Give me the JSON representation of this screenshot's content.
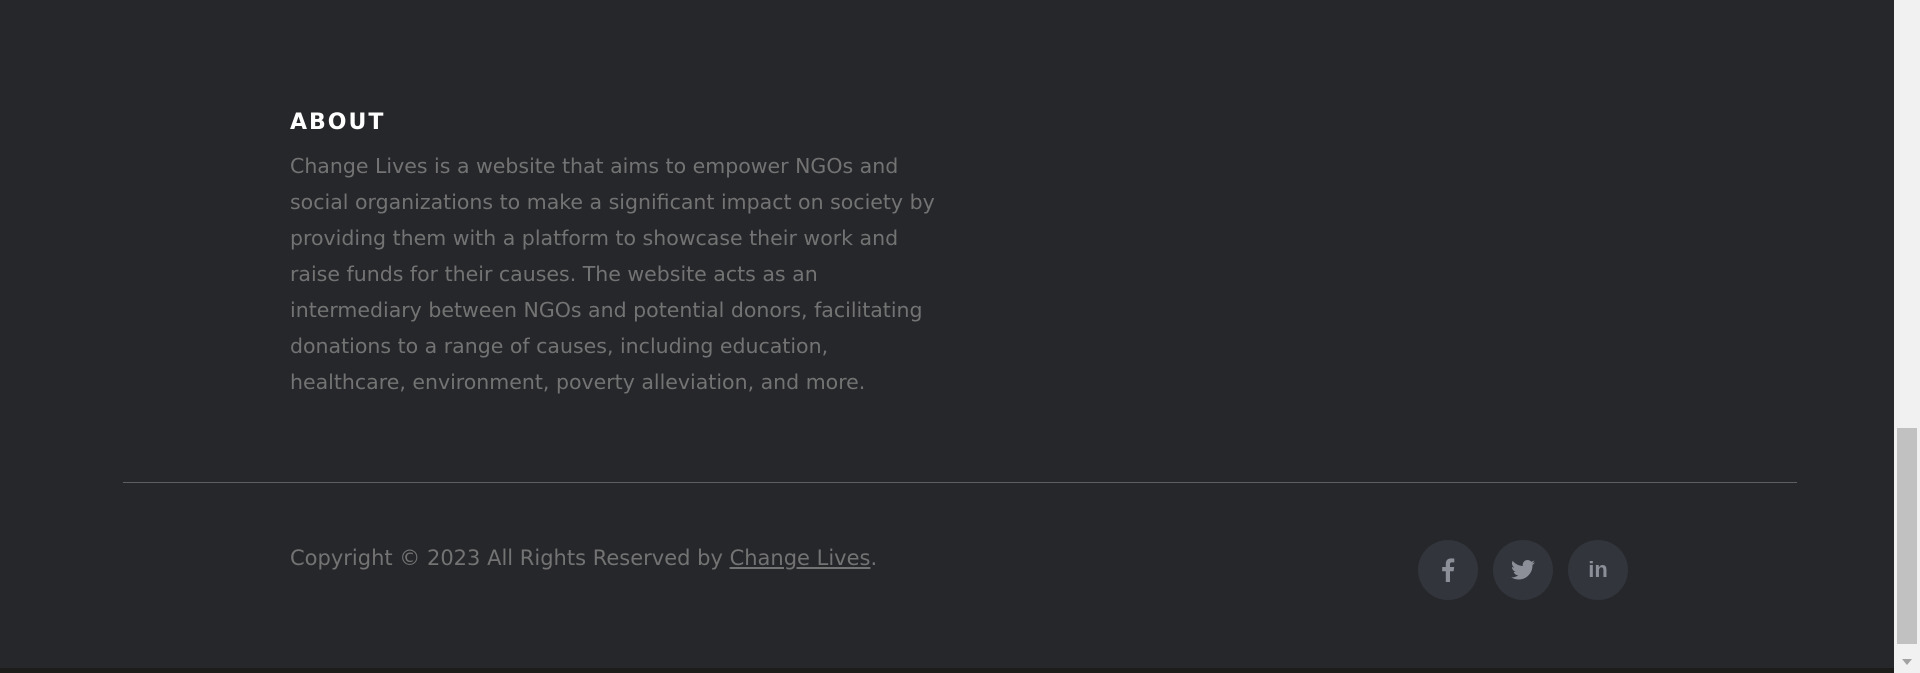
{
  "about": {
    "title": "ABOUT",
    "text": "Change Lives is a website that aims to empower NGOs and social organizations to make a significant impact on society by providing them with a platform to showcase their work and raise funds for their causes. The website acts as an intermediary between NGOs and potential donors, facilitating donations to a range of causes, including education, healthcare, environment, poverty alleviation, and more."
  },
  "footer": {
    "copyright_prefix": "Copyright © 2023 All Rights Reserved by ",
    "copyright_link": "Change Lives",
    "copyright_suffix": "."
  },
  "social": {
    "facebook_icon": "facebook-icon",
    "twitter_icon": "twitter-icon",
    "linkedin_icon": "linkedin-icon",
    "linkedin_text": "in"
  },
  "colors": {
    "background": "#26272b",
    "heading": "#ffffff",
    "text": "#737373",
    "social_bg": "#33353d",
    "social_icon": "#8c8f98"
  }
}
